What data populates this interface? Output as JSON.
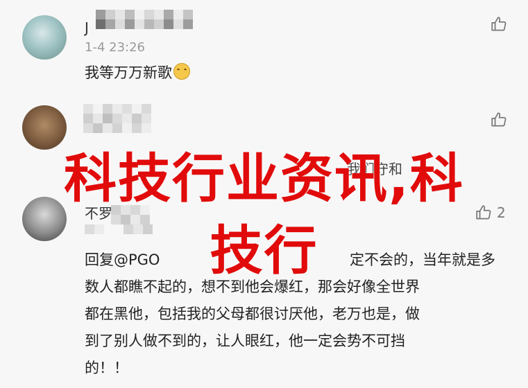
{
  "comments": [
    {
      "name_visible": "J",
      "time": "1-4 23:26",
      "text": "我等万万新歌",
      "emoji": "smile-emoji",
      "likes": ""
    },
    {
      "name_visible": "",
      "time": "",
      "text_partial": "我们守和",
      "likes": ""
    },
    {
      "name_visible": "不罗",
      "time": "",
      "likes": "2",
      "reply_lines": [
        "回复@PGO",
        "定不会的，当年就是多",
        "数人都瞧不起的，想不到他会爆红，那会好像全世界",
        "都在黑他，包括我的父母都很讨厌他，老万也是，做",
        "到了别人做不到的，让人眼红，他一定会势不可挡",
        "的！！"
      ]
    }
  ],
  "overlay": {
    "line1": "科技行业资讯,科",
    "line2": "技行",
    "color": "#e10b0b"
  }
}
